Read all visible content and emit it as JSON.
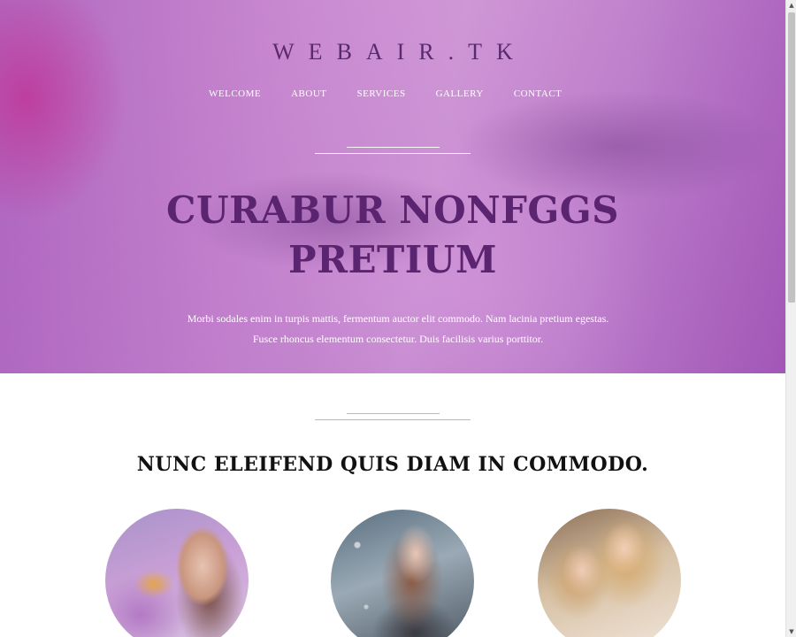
{
  "header": {
    "logo": "WEBAIR.TK",
    "nav": [
      "WELCOME",
      "ABOUT",
      "SERVICES",
      "GALLERY",
      "CONTACT"
    ]
  },
  "hero": {
    "title_line1": "CURABUR NONFGGS",
    "title_line2": "PRETIUM",
    "text_line1": "Morbi sodales enim in turpis mattis, fermentum auctor elit commodo. Nam lacinia pretium egestas.",
    "text_line2": "Fusce rhoncus elementum consectetur. Duis facilisis varius porttitor."
  },
  "section": {
    "title": "NUNC ELEIFEND QUIS DIAM IN COMMODO."
  },
  "colors": {
    "hero_overlay": "#c98bd2",
    "title_purple": "#5b2470"
  }
}
